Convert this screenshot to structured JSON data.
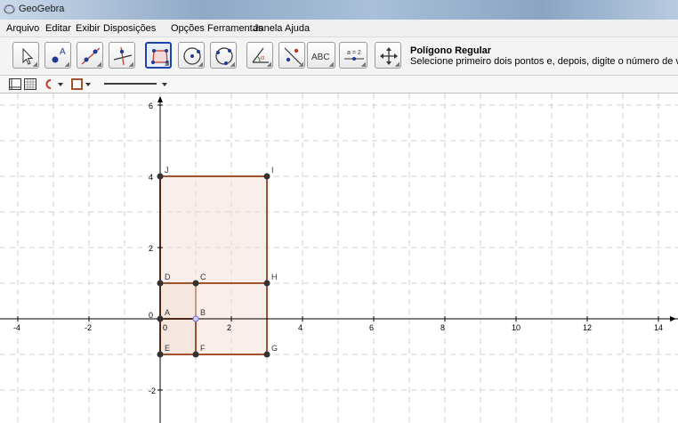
{
  "window": {
    "title": "GeoGebra"
  },
  "menu": {
    "items": [
      "Arquivo",
      "Editar",
      "Exibir",
      "Disposições",
      "Opções",
      "Ferramentas",
      "Janela",
      "Ajuda"
    ]
  },
  "toolbar": {
    "tools": [
      {
        "name": "move-tool",
        "icon": "arrow-cursor-icon",
        "selected": false,
        "label": ""
      },
      {
        "name": "point-tool",
        "icon": "point-icon",
        "selected": false,
        "label": ""
      },
      {
        "name": "line-tool",
        "icon": "line-through-points-icon",
        "selected": false,
        "label": ""
      },
      {
        "name": "perpendicular-tool",
        "icon": "perpendicular-line-icon",
        "selected": false,
        "label": ""
      },
      {
        "name": "polygon-tool",
        "icon": "regular-polygon-icon",
        "selected": true,
        "label": ""
      },
      {
        "name": "circle-tool",
        "icon": "circle-center-point-icon",
        "selected": false,
        "label": ""
      },
      {
        "name": "circle-three-points-tool",
        "icon": "circle-three-points-icon",
        "selected": false,
        "label": ""
      },
      {
        "name": "angle-tool",
        "icon": "angle-icon",
        "selected": false,
        "label": ""
      },
      {
        "name": "reflect-tool",
        "icon": "reflect-about-line-icon",
        "selected": false,
        "label": ""
      },
      {
        "name": "text-tool",
        "icon": "text-icon",
        "selected": false,
        "label": "ABC"
      },
      {
        "name": "slider-tool",
        "icon": "slider-icon",
        "selected": false,
        "label": "a = 2"
      },
      {
        "name": "move-view-tool",
        "icon": "move-graphics-view-icon",
        "selected": false,
        "label": ""
      }
    ],
    "help_title": "Polígono Regular",
    "help_text": "Selecione primeiro dois pontos e, depois, digite o número de vértices"
  },
  "stylebar": {
    "items": [
      "axes-toggle-icon",
      "grid-toggle-icon",
      "point-capture-icon",
      "color-icon",
      "line-style-icon"
    ]
  },
  "graphics": {
    "x_ticks": [
      "-4",
      "-2",
      "0",
      "2",
      "4",
      "6",
      "8",
      "10",
      "12",
      "14"
    ],
    "y_ticks": [
      "6",
      "4",
      "2",
      "0",
      "-2"
    ],
    "points": [
      {
        "label": "A",
        "x": 0,
        "y": 0
      },
      {
        "label": "B",
        "x": 1,
        "y": 0
      },
      {
        "label": "C",
        "x": 1,
        "y": 1
      },
      {
        "label": "D",
        "x": 0,
        "y": 1
      },
      {
        "label": "E",
        "x": 0,
        "y": -1
      },
      {
        "label": "F",
        "x": 1,
        "y": -1
      },
      {
        "label": "G",
        "x": 3,
        "y": -1
      },
      {
        "label": "H",
        "x": 3,
        "y": 1
      },
      {
        "label": "I",
        "x": 3,
        "y": 4
      },
      {
        "label": "J",
        "x": 0,
        "y": 4
      }
    ],
    "polygons": [
      {
        "name": "square-ABCD",
        "vertices": [
          "A",
          "B",
          "C",
          "D"
        ]
      },
      {
        "name": "rectangle-DHIJ",
        "vertices": [
          "D",
          "H",
          "I",
          "J"
        ]
      },
      {
        "name": "rectangle-EGHD",
        "vertices": [
          "E",
          "G",
          "H",
          "D"
        ]
      },
      {
        "name": "rectangle-EFBA",
        "vertices": [
          "E",
          "F",
          "B",
          "A"
        ]
      }
    ],
    "colors": {
      "polygon_stroke": "#a0522d",
      "polygon_fill": "#f3ddd5",
      "point": "#333333",
      "selected_point": "#6f6fd7"
    }
  }
}
